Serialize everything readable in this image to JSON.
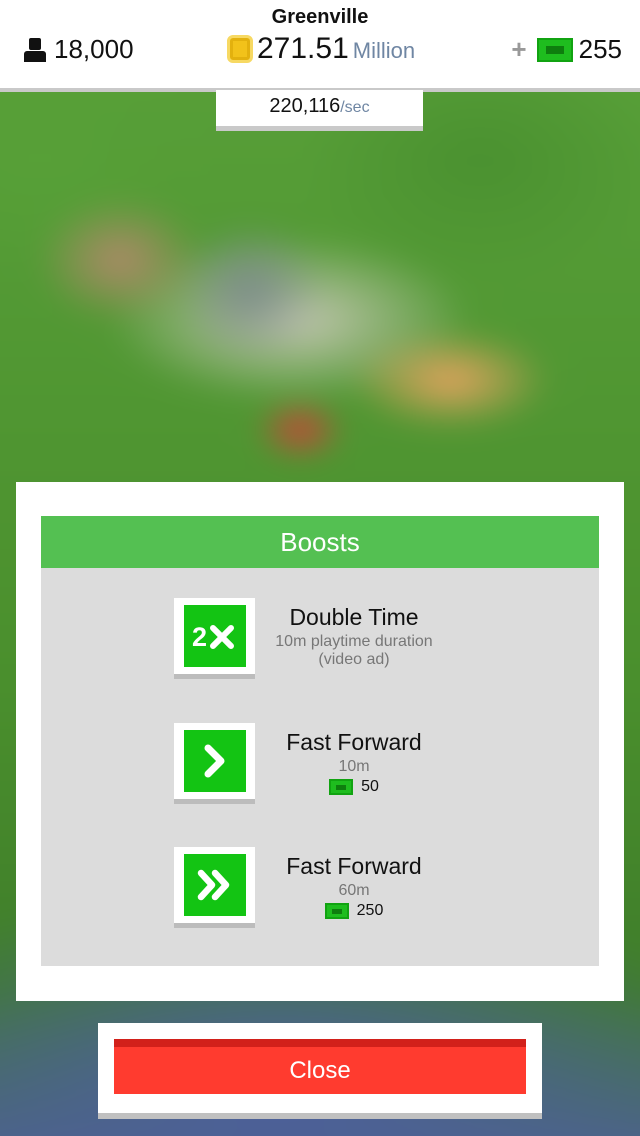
{
  "hud": {
    "city_name": "Greenville",
    "population": "18,000",
    "money_value": "271.51",
    "money_unit": "Million",
    "cash_plus": "+",
    "cash_value": "255",
    "rate_value": "220,116",
    "rate_unit": "/sec"
  },
  "dialog": {
    "title": "Boosts",
    "boosts": [
      {
        "title": "Double Time",
        "line1": "10m playtime duration",
        "line2": "(video ad)",
        "icon": "double-speed-2x-icon"
      },
      {
        "title": "Fast Forward",
        "line1": "10m",
        "cost": "50",
        "icon": "chevron-right-icon"
      },
      {
        "title": "Fast Forward",
        "line1": "60m",
        "cost": "250",
        "icon": "double-chevron-right-icon"
      }
    ],
    "close_label": "Close"
  },
  "colors": {
    "accent_green": "#54c052",
    "icon_green": "#13c413",
    "close_red": "#ff3b2f",
    "muted_blue": "#6f86a3"
  }
}
